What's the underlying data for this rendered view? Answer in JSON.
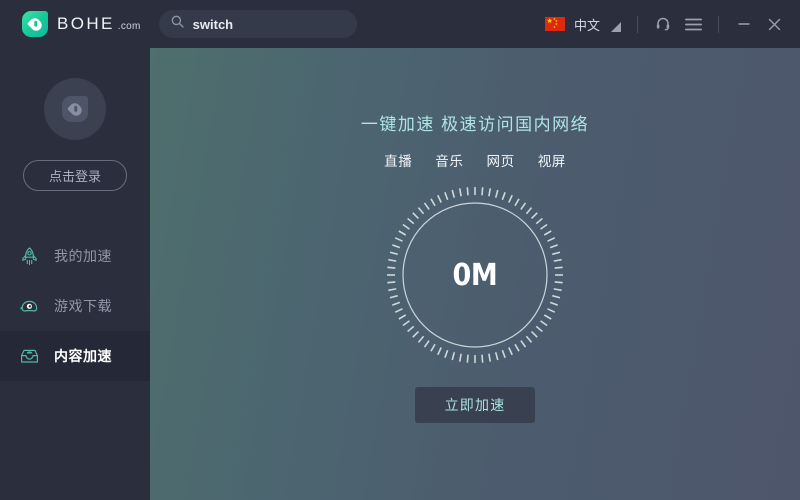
{
  "titlebar": {
    "brand_name": "BOHE",
    "brand_suffix": ".com",
    "logo_icon": "bohe-leaf-logo-icon",
    "search": {
      "value": "switch",
      "placeholder": "switch",
      "icon": "search-icon"
    },
    "language": {
      "flag": "china-flag-icon",
      "label": "中文",
      "caret": "chevron-down-icon"
    },
    "headset_icon": "headset-icon",
    "menu_icon": "hamburger-menu-icon",
    "minimize_icon": "minimize-icon",
    "close_icon": "close-icon"
  },
  "sidebar": {
    "avatar_icon": "user-avatar-icon",
    "login_label": "点击登录",
    "items": [
      {
        "label": "我的加速",
        "icon": "rocket-icon",
        "active": false
      },
      {
        "label": "游戏下载",
        "icon": "game-alien-icon",
        "active": false
      },
      {
        "label": "内容加速",
        "icon": "inbox-box-icon",
        "active": true
      }
    ]
  },
  "main": {
    "hero_title": "一键加速 极速访问国内网络",
    "tags": [
      "直播",
      "音乐",
      "网页",
      "视屏"
    ],
    "dial": {
      "value": "0M",
      "ticks": 72
    },
    "cta_label": "立即加速"
  },
  "colors": {
    "accent_green": "#16c79a",
    "accent_teal_text": "#aee5e3",
    "sidebar_bg": "#2b2f3d",
    "sidebar_active_bg": "#242837",
    "main_gradient_left": "#4e6f6d",
    "main_gradient_right": "#4e566c",
    "flag_red": "#de2910",
    "flag_yellow": "#ffde00"
  }
}
